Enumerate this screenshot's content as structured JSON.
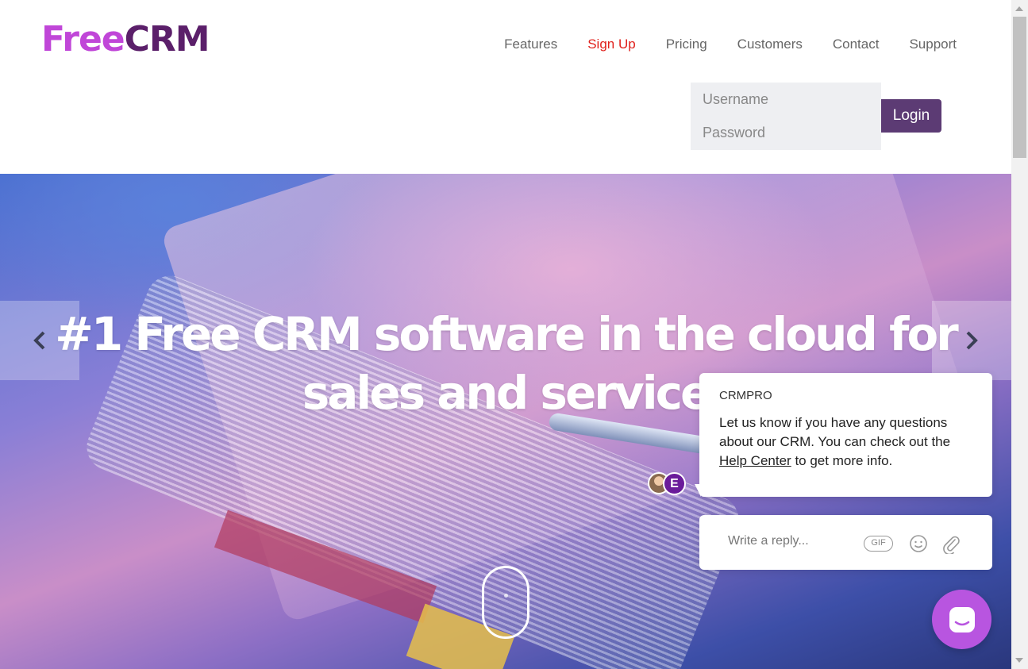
{
  "brand": {
    "part1": "Free",
    "part2": "CRM"
  },
  "nav": [
    {
      "label": "Features"
    },
    {
      "label": "Sign Up"
    },
    {
      "label": "Pricing"
    },
    {
      "label": "Customers"
    },
    {
      "label": "Contact"
    },
    {
      "label": "Support"
    }
  ],
  "login": {
    "username_placeholder": "Username",
    "password_placeholder": "Password",
    "button_label": "Login"
  },
  "hero": {
    "headline": "#1 Free CRM software in the cloud for sales and service"
  },
  "chat": {
    "sender": "CRMPRO",
    "message_before": "Let us know if you have any questions about our CRM.  You can check out the ",
    "link_text": "Help Center",
    "message_after": " to get more info.",
    "avatar_initial": "E",
    "reply_placeholder": "Write a reply...",
    "gif_label": "GIF"
  },
  "colors": {
    "brand_light": "#c046d8",
    "brand_dark": "#5b1f6a",
    "signup": "#e0211c",
    "login_button": "#5c3b74",
    "launcher": "#b855e0"
  }
}
